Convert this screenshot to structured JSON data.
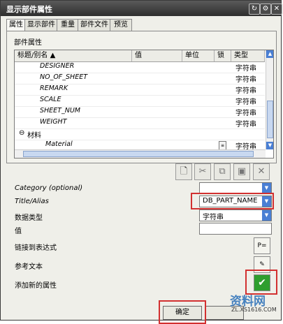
{
  "window": {
    "title": "显示部件属性"
  },
  "tabs": [
    {
      "label": "属性",
      "active": true
    },
    {
      "label": "显示部件",
      "active": false
    },
    {
      "label": "重量",
      "active": false
    },
    {
      "label": "部件文件",
      "active": false
    },
    {
      "label": "预览",
      "active": false
    }
  ],
  "group": {
    "title": "部件属性"
  },
  "table": {
    "columns": [
      "标题/别名",
      "值",
      "单位",
      "锁",
      "类型"
    ],
    "rows": [
      {
        "title": "DESIGNER",
        "type": "字符串"
      },
      {
        "title": "NO_OF_SHEET",
        "type": "字符串"
      },
      {
        "title": "REMARK",
        "type": "字符串"
      },
      {
        "title": "SCALE",
        "type": "字符串"
      },
      {
        "title": "SHEET_NUM",
        "type": "字符串"
      },
      {
        "title": "WEIGHT",
        "type": "字符串"
      }
    ],
    "category_row": {
      "expander": "⊖",
      "label": "材料"
    },
    "material_row": {
      "title": "Material",
      "type": "字符串"
    }
  },
  "form": {
    "category_label": "Category (optional)",
    "category_value": "",
    "title_label": "Title/Alias",
    "title_value": "DB_PART_NAME",
    "datatype_label": "数据类型",
    "datatype_value": "字符串",
    "value_label": "值",
    "value_value": "",
    "link_label": "链接到表达式",
    "reftext_label": "参考文本",
    "add_label": "添加新的属性"
  },
  "buttons": {
    "ok": "确定"
  },
  "watermark": {
    "main": "资料网",
    "sub": "ZL.XS1616.COM"
  },
  "colors": {
    "highlight_box": "#d23030",
    "accent": "#4a7fd4",
    "check": "#2e9e2e"
  }
}
